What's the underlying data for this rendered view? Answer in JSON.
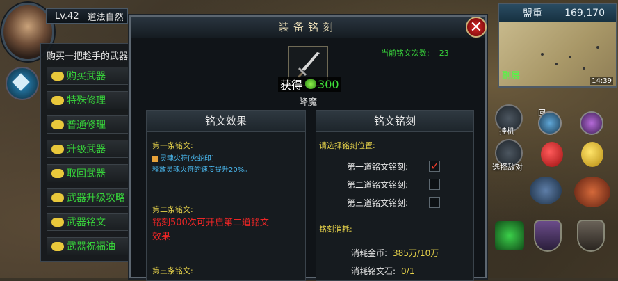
{
  "player": {
    "level": "Lv.42",
    "name": "道法自然"
  },
  "left_menu": {
    "intro": "购买一把趁手的武器",
    "items": [
      "购买武器",
      "特殊修理",
      "普通修理",
      "升级武器",
      "取回武器",
      "武器升级攻略",
      "武器铭文",
      "武器祝福油"
    ]
  },
  "dialog": {
    "title": "装备铭刻",
    "close_symbol": "✕",
    "inscription_count_label": "当前铭文次数:",
    "inscription_count_value": "23",
    "obtain_label": "获得",
    "obtain_value": "300",
    "weapon_name": "降魔",
    "effects": {
      "header": "铭文效果",
      "first_label": "第一条铭文:",
      "first_rune": "灵魂火符[火蛇印]",
      "first_desc": "释放灵魂火符的速度提升20%。",
      "second_label": "第二条铭文:",
      "second_desc_line1": "铭刻500次可开启第二道铭文",
      "second_desc_line2": "效果",
      "third_label": "第三条铭文:"
    },
    "engrave": {
      "header": "铭文铭刻",
      "select_label": "请选择铭刻位置:",
      "slots": [
        {
          "label": "第一道铭文铭刻:",
          "checked": true,
          "mark": "✓"
        },
        {
          "label": "第二道铭文铭刻:",
          "checked": false
        },
        {
          "label": "第三道铭文铭刻:",
          "checked": false
        }
      ],
      "cost_label": "铭刻消耗:",
      "gold_label": "消耗金币:",
      "gold_value": "385万/10万",
      "stone_label": "消耗铭文石:",
      "stone_value": "0/1"
    }
  },
  "minimap": {
    "server": "盟重",
    "coords": "169,170",
    "zone": "副层",
    "time": "14:39"
  },
  "hud": {
    "auto_hang": "挂机",
    "select_target": "选择敌对",
    "return": "回"
  },
  "colors": {
    "menu_text": "#37d23a",
    "label_yellow": "#e6d24a",
    "rune_blue": "#4ab8ee",
    "warn_red": "#ee2626"
  }
}
